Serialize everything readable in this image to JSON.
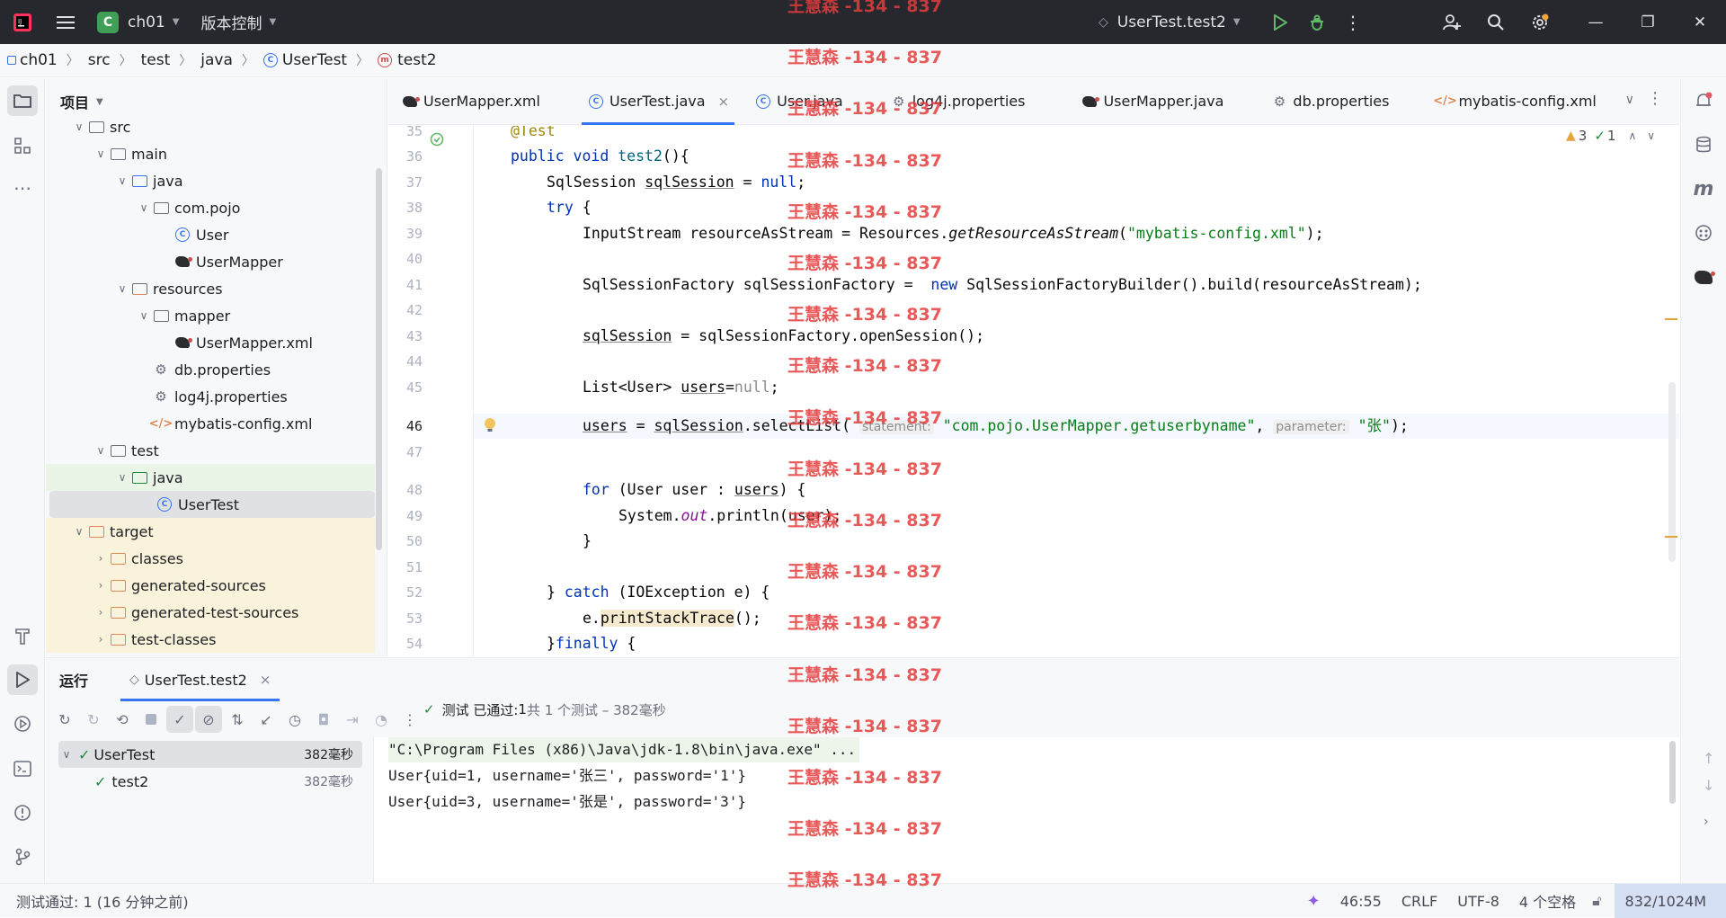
{
  "titlebar": {
    "project_badge": "C",
    "project_name": "ch01",
    "vcs_menu": "版本控制",
    "run_config": "UserTest.test2"
  },
  "breadcrumb": [
    "ch01",
    "src",
    "test",
    "java",
    "UserTest",
    "test2"
  ],
  "project_panel": {
    "title": "项目",
    "tree": [
      {
        "label": "src",
        "indent": 0,
        "expanded": true,
        "icon": "folder-icon"
      },
      {
        "label": "main",
        "indent": 1,
        "expanded": true,
        "icon": "folder-icon"
      },
      {
        "label": "java",
        "indent": 2,
        "expanded": true,
        "icon": "source-folder-icon"
      },
      {
        "label": "com.pojo",
        "indent": 3,
        "expanded": true,
        "icon": "package-icon"
      },
      {
        "label": "User",
        "indent": 4,
        "icon": "class-icon"
      },
      {
        "label": "UserMapper",
        "indent": 4,
        "icon": "mybatis-icon"
      },
      {
        "label": "resources",
        "indent": 2,
        "expanded": true,
        "icon": "resources-folder-icon"
      },
      {
        "label": "mapper",
        "indent": 3,
        "expanded": true,
        "icon": "folder-icon"
      },
      {
        "label": "UserMapper.xml",
        "indent": 4,
        "icon": "mybatis-icon"
      },
      {
        "label": "db.properties",
        "indent": 3,
        "icon": "properties-icon"
      },
      {
        "label": "log4j.properties",
        "indent": 3,
        "icon": "properties-icon"
      },
      {
        "label": "mybatis-config.xml",
        "indent": 3,
        "icon": "xml-icon"
      },
      {
        "label": "test",
        "indent": 1,
        "expanded": true,
        "icon": "folder-icon"
      },
      {
        "label": "java",
        "indent": 2,
        "expanded": true,
        "icon": "test-folder-icon"
      },
      {
        "label": "UserTest",
        "indent": 3,
        "icon": "class-icon",
        "selected": true
      },
      {
        "label": "target",
        "indent": 0,
        "expanded": true,
        "icon": "excluded-folder-icon"
      },
      {
        "label": "classes",
        "indent": 1,
        "expanded": false,
        "icon": "excluded-folder-icon"
      },
      {
        "label": "generated-sources",
        "indent": 1,
        "expanded": false,
        "icon": "excluded-folder-icon"
      },
      {
        "label": "generated-test-sources",
        "indent": 1,
        "expanded": false,
        "icon": "excluded-folder-icon"
      },
      {
        "label": "test-classes",
        "indent": 1,
        "expanded": false,
        "icon": "excluded-folder-icon"
      }
    ]
  },
  "editor_tabs": [
    {
      "label": "UserMapper.xml",
      "icon": "mybatis-icon"
    },
    {
      "label": "UserTest.java",
      "icon": "class-icon",
      "active": true,
      "close": "×"
    },
    {
      "label": "User.java",
      "icon": "class-icon"
    },
    {
      "label": "log4j.properties",
      "icon": "properties-icon"
    },
    {
      "label": "UserMapper.java",
      "icon": "mybatis-icon"
    },
    {
      "label": "db.properties",
      "icon": "properties-icon"
    },
    {
      "label": "mybatis-config.xml",
      "icon": "xml-icon"
    }
  ],
  "inspections": {
    "warnings": "3",
    "ok": "1"
  },
  "code": {
    "line_numbers": [
      "35",
      "36",
      "37",
      "38",
      "39",
      "40",
      "41",
      "42",
      "43",
      "44",
      "45",
      "46",
      "47",
      "48",
      "49",
      "50",
      "51",
      "52",
      "53",
      "54"
    ],
    "l35": "@Test",
    "l36_kw": "public void ",
    "l36_fn": "test2",
    "l36_rest": "(){",
    "l37_a": "SqlSession ",
    "l37_b": "sqlSession",
    "l37_c": " = ",
    "l37_d": "null",
    "l37_e": ";",
    "l38_kw": "try",
    "l38_rest": " {",
    "l39_a": "InputStream resourceAsStream = Resources.",
    "l39_b": "getResourceAsStream",
    "l39_c": "(",
    "l39_d": "\"mybatis-config.xml\"",
    "l39_e": ");",
    "l41_a": "SqlSessionFactory sqlSessionFactory =  ",
    "l41_kw": "new",
    "l41_b": " SqlSessionFactoryBuilder().build(resourceAsStream);",
    "l43_a": "sqlSession",
    "l43_b": " = sqlSessionFactory.openSession();",
    "l45_a": "List<User> ",
    "l45_b": "users",
    "l45_c": "=",
    "l45_d": "null",
    "l45_e": ";",
    "l46_a": "users",
    "l46_b": " = ",
    "l46_c": "sqlSession",
    "l46_d": ".selectList( ",
    "l46_h1": "statement:",
    "l46_s1": "\"com.pojo.UserMapper.getuserbyname\"",
    "l46_e": ", ",
    "l46_h2": "parameter:",
    "l46_s2": "\"张\"",
    "l46_f": ");",
    "l48_kw": "for",
    "l48_a": " (User user : ",
    "l48_b": "users",
    "l48_c": ") {",
    "l49_a": "System.",
    "l49_b": "out",
    "l49_c": ".println(user);",
    "l50": "}",
    "l52_a": "} ",
    "l52_kw": "catch",
    "l52_b": " (IOException e) {",
    "l53_a": "e.",
    "l53_b": "printStackTrace",
    "l53_c": "();",
    "l54_a": "}",
    "l54_kw": "finally",
    "l54_b": " {"
  },
  "run_panel": {
    "title": "运行",
    "tab": "UserTest.test2",
    "summary_prefix": "测试 已通过: ",
    "summary_count": "1",
    "summary_suffix": "共 1 个测试 – 382毫秒",
    "tree": [
      {
        "label": "UserTest",
        "time": "382毫秒",
        "indent": 0
      },
      {
        "label": "test2",
        "time": "382毫秒",
        "indent": 1
      }
    ],
    "console": [
      "\"C:\\Program Files (x86)\\Java\\jdk-1.8\\bin\\java.exe\" ...",
      "User{uid=1, username='张三', password='1'}",
      "User{uid=3, username='张是', password='3'}"
    ]
  },
  "statusbar": {
    "left": "测试通过: 1 (16 分钟之前)",
    "position": "46:55",
    "line_sep": "CRLF",
    "encoding": "UTF-8",
    "indent": "4 个空格",
    "memory": "832/1024M"
  },
  "watermark": "王慧森 -134 - 837"
}
